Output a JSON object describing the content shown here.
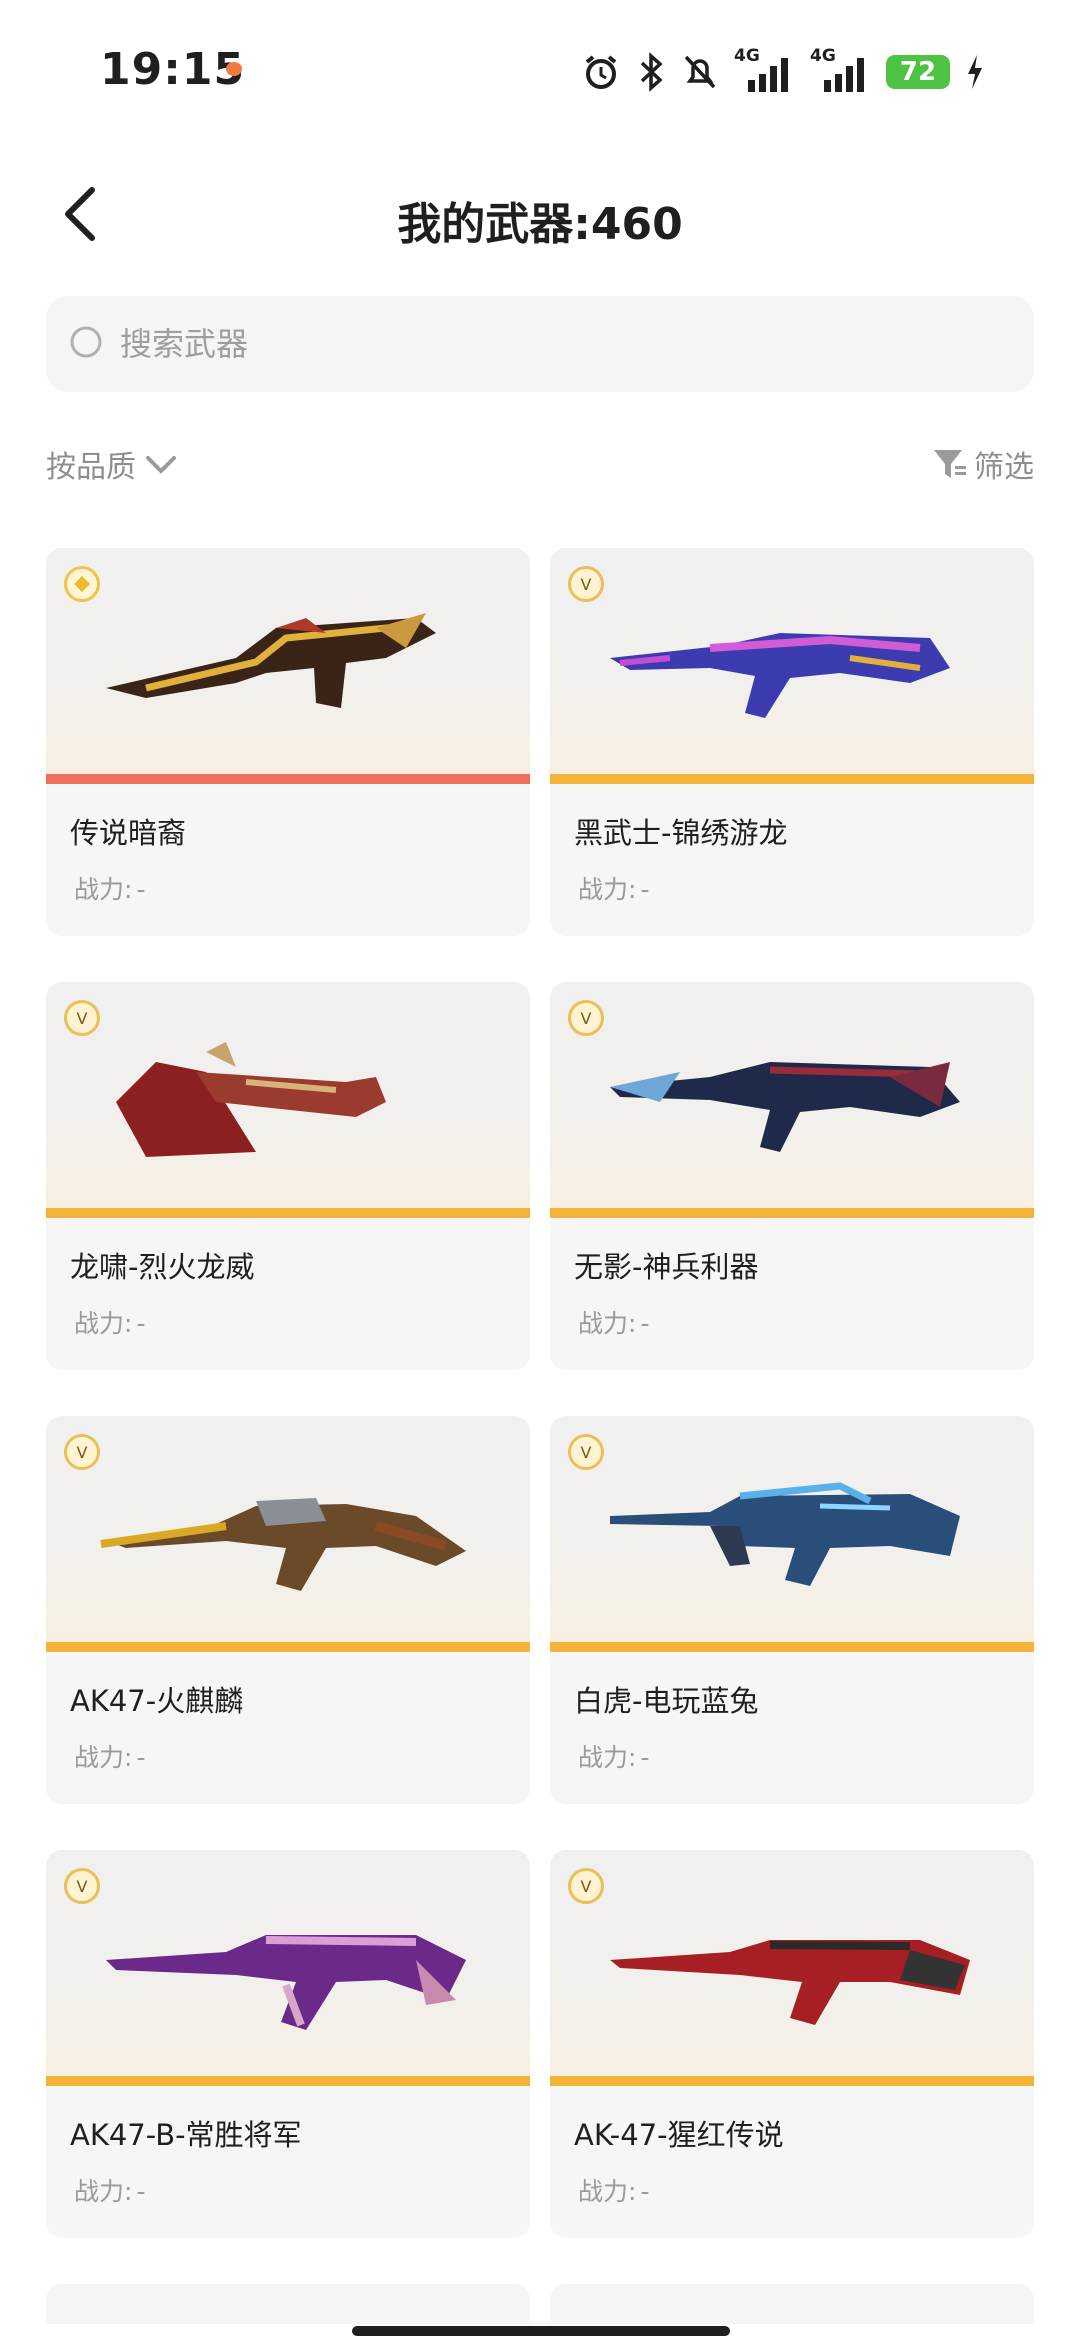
{
  "status_bar": {
    "time": "19:15",
    "icons": [
      "alarm-icon",
      "bluetooth-icon",
      "mute-icon",
      "signal-4g-icon",
      "signal-4g-icon",
      "battery-icon",
      "charging-icon"
    ],
    "network_1": "4G",
    "network_2": "4G",
    "battery": "72"
  },
  "header": {
    "title": "我的武器:460",
    "back_icon": "chevron-left-icon"
  },
  "search": {
    "placeholder": "搜索武器",
    "value": ""
  },
  "sortbar": {
    "sort_label": "按品质",
    "filter_label": "筛选"
  },
  "weapons": [
    {
      "name": "传说暗裔",
      "power_label": "战力:",
      "power_value": "-",
      "tier": "legendary"
    },
    {
      "name": "黑武士-锦绣游龙",
      "power_label": "战力:",
      "power_value": "-",
      "tier": "v"
    },
    {
      "name": "龙啸-烈火龙威",
      "power_label": "战力:",
      "power_value": "-",
      "tier": "v"
    },
    {
      "name": "无影-神兵利器",
      "power_label": "战力:",
      "power_value": "-",
      "tier": "v"
    },
    {
      "name": "AK47-火麒麟",
      "power_label": "战力:",
      "power_value": "-",
      "tier": "v"
    },
    {
      "name": "白虎-电玩蓝兔",
      "power_label": "战力:",
      "power_value": "-",
      "tier": "v"
    },
    {
      "name": "AK47-B-常胜将军",
      "power_label": "战力:",
      "power_value": "-",
      "tier": "v"
    },
    {
      "name": "AK-47-猩红传说",
      "power_label": "战力:",
      "power_value": "-",
      "tier": "v"
    }
  ],
  "colors": {
    "legendary_stripe": "#ee6f5e",
    "v_stripe": "#f4b43a",
    "battery": "#4cc341"
  }
}
